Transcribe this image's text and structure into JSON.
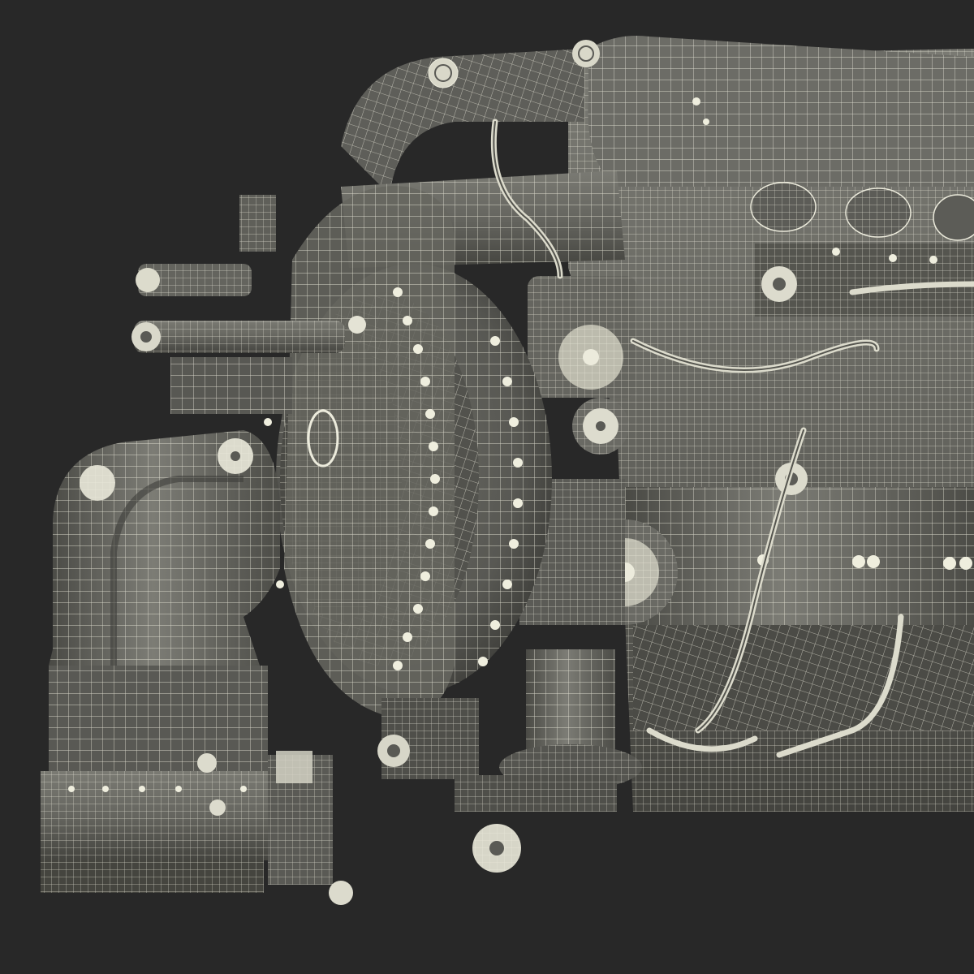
{
  "scene": {
    "subject": "engine-wireframe-render",
    "colors": {
      "background": "#282828",
      "surface": "#5f5f5a",
      "surface_dark": "#3c3c39",
      "surface_light": "#7b7b74",
      "wire": "#ecebdc"
    }
  }
}
